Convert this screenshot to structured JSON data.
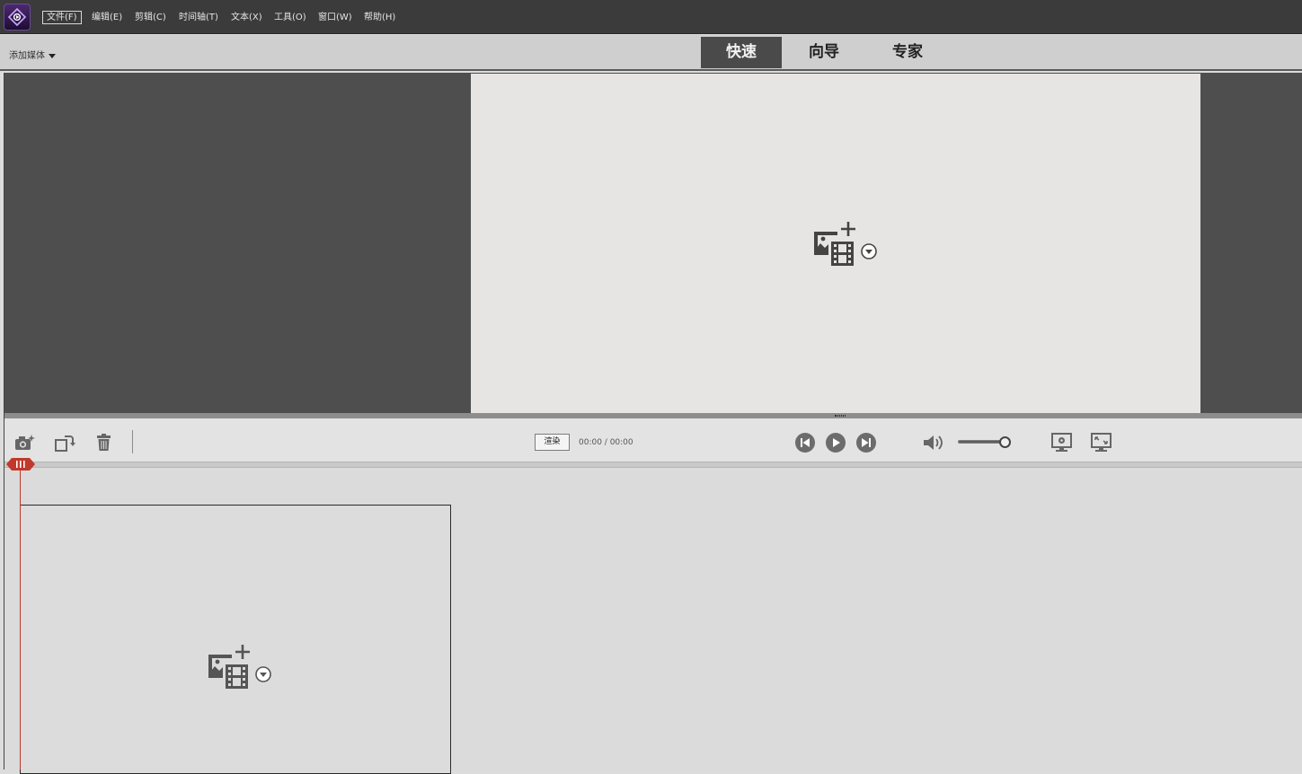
{
  "app": {
    "logo_icon": "premiere-elements-logo-icon"
  },
  "menu": {
    "items": [
      {
        "label": "文件(F)",
        "active": true
      },
      {
        "label": "编辑(E)",
        "active": false
      },
      {
        "label": "剪辑(C)",
        "active": false
      },
      {
        "label": "时间轴(T)",
        "active": false
      },
      {
        "label": "文本(X)",
        "active": false
      },
      {
        "label": "工具(O)",
        "active": false
      },
      {
        "label": "窗口(W)",
        "active": false
      },
      {
        "label": "帮助(H)",
        "active": false
      }
    ]
  },
  "modebar": {
    "add_media_label": "添加媒体",
    "tabs": [
      {
        "label": "快速",
        "active": true
      },
      {
        "label": "向导",
        "active": false
      },
      {
        "label": "专家",
        "active": false
      }
    ]
  },
  "preview": {
    "add_media_icon": "add-media-icon",
    "dropdown_icon": "chevron-down-circle-icon"
  },
  "controls": {
    "snapshot_icon": "camera-icon",
    "rotate_icon": "rotate-icon",
    "delete_icon": "trash-icon",
    "render_label": "渲染",
    "timecode": "00:00 / 00:00",
    "prev_icon": "step-back-icon",
    "play_icon": "play-icon",
    "next_icon": "step-forward-icon",
    "volume_icon": "speaker-icon",
    "volume_level": 0.9,
    "settings_icon": "monitor-settings-icon",
    "fullscreen_icon": "fullscreen-icon"
  },
  "timeline": {
    "playhead_icon": "playhead-icon",
    "clip_add_media_icon": "add-media-icon"
  },
  "colors": {
    "menubar_bg": "#3b3b3b",
    "modebar_bg": "#cfcfcf",
    "active_tab_bg": "#4a4a4a",
    "monitor_bg": "#4e4e4e",
    "preview_bg": "#e6e5e3",
    "playhead": "#c0392b"
  }
}
